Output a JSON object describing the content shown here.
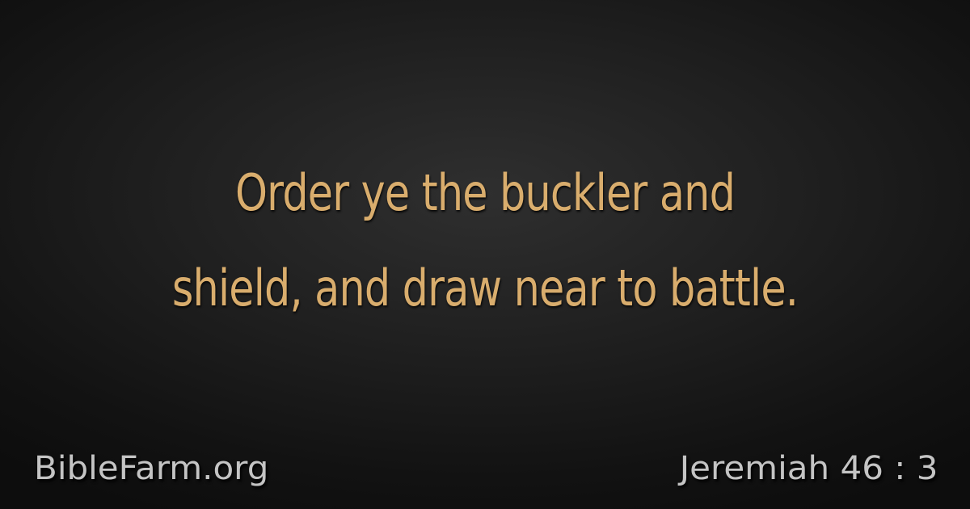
{
  "verse": {
    "line1": "Order ye the buckler and",
    "line2": "shield, and draw near to battle."
  },
  "footer": {
    "site": "BibleFarm.org",
    "reference": "Jeremiah 46 : 3"
  },
  "colors": {
    "verse_text": "#d9ad6d",
    "footer_text": "#c4c4c4",
    "background": "#1f1f1f"
  }
}
